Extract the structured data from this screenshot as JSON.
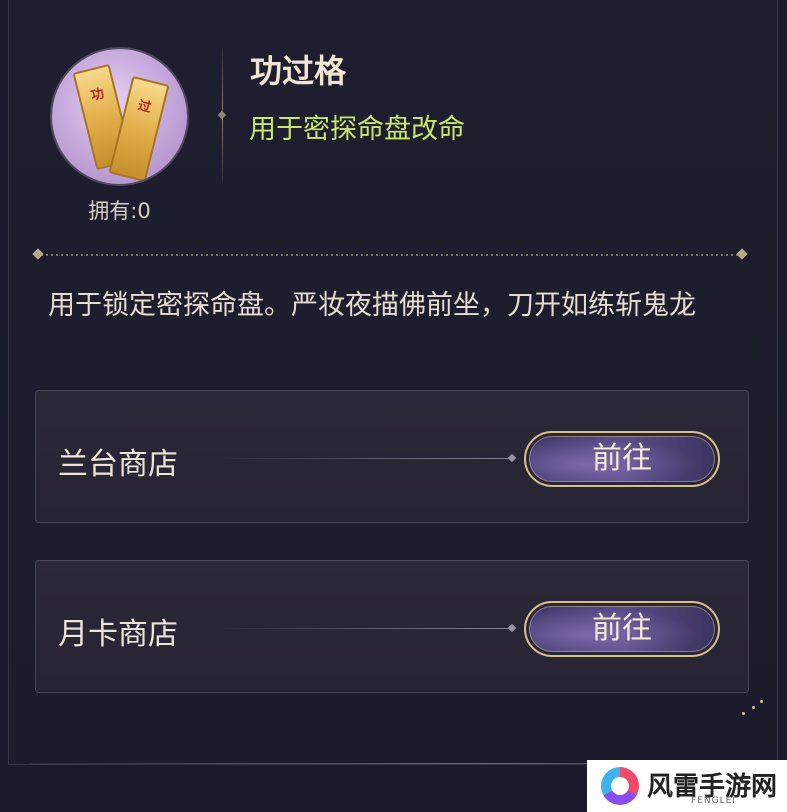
{
  "item": {
    "name": "功过格",
    "subtitle": "用于密探命盘改命",
    "icon": "talisman-icon",
    "icon_chars": [
      "功",
      "过"
    ],
    "owned_label": "拥有:0"
  },
  "description": "用于锁定密探命盘。严妆夜描佛前坐，刀开如练斩鬼龙",
  "shops": [
    {
      "name": "兰台商店",
      "button_label": "前往"
    },
    {
      "name": "月卡商店",
      "button_label": "前往"
    }
  ],
  "watermark": {
    "text": "风雷手游网",
    "sub": "FENGLEI"
  },
  "colors": {
    "subtitle": "#c7e86a",
    "title": "#f0e6cf",
    "button_border": "#d5c08a",
    "background": "#1b1a2c"
  }
}
